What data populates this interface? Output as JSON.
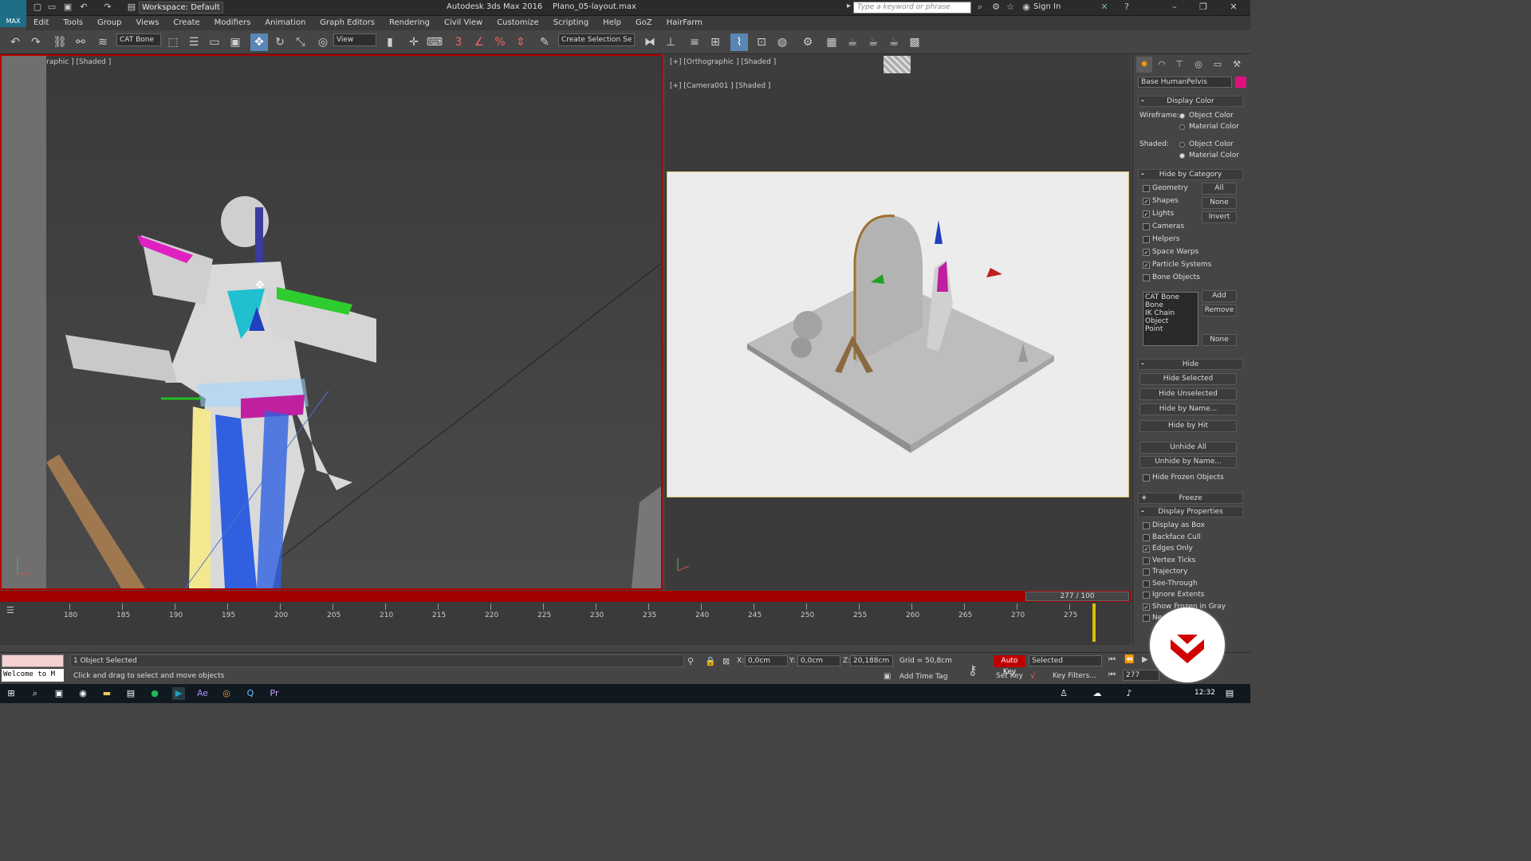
{
  "window": {
    "workspace_label": "Workspace: Default",
    "app_title": "Autodesk 3ds Max 2016",
    "file_name": "Plano_05-layout.max",
    "search_placeholder": "Type a keyword or phrase",
    "sign_in": "Sign In",
    "logo_text": "MAX"
  },
  "menu": [
    "Edit",
    "Tools",
    "Group",
    "Views",
    "Create",
    "Modifiers",
    "Animation",
    "Graph Editors",
    "Rendering",
    "Civil View",
    "Customize",
    "Scripting",
    "Help",
    "GoZ",
    "HairFarm"
  ],
  "toolbar": {
    "selection_filter": "CAT Bone",
    "ref_coord": "View",
    "named_selection": "Create Selection Se"
  },
  "viewports": {
    "left_label": "[+] [Orthographic ] [Shaded ]",
    "right_top_label": "[+] [Orthographic ] [Shaded ]",
    "right_label": "[+] [Camera001 ] [Shaded ]"
  },
  "command_panel": {
    "object_name": "Base HumanPelvis",
    "object_color": "#e0117f",
    "display_color": {
      "title": "Display Color",
      "wireframe_label": "Wireframe:",
      "shaded_label": "Shaded:",
      "object_color": "Object Color",
      "material_color": "Material Color"
    },
    "hide_by_category": {
      "title": "Hide by Category",
      "items": [
        {
          "label": "Geometry",
          "checked": false
        },
        {
          "label": "Shapes",
          "checked": true
        },
        {
          "label": "Lights",
          "checked": true
        },
        {
          "label": "Cameras",
          "checked": false
        },
        {
          "label": "Helpers",
          "checked": false
        },
        {
          "label": "Space Warps",
          "checked": true
        },
        {
          "label": "Particle Systems",
          "checked": true
        },
        {
          "label": "Bone Objects",
          "checked": false
        }
      ],
      "buttons": [
        "All",
        "None",
        "Invert"
      ],
      "list": [
        "CAT Bone",
        "Bone",
        "IK Chain Object",
        "Point"
      ],
      "list_buttons": [
        "Add",
        "Remove",
        "None"
      ]
    },
    "hide": {
      "title": "Hide",
      "buttons": [
        "Hide Selected",
        "Hide Unselected",
        "Hide by Name...",
        "Hide by Hit",
        "Unhide All",
        "Unhide by Name..."
      ],
      "frozen_label": "Hide Frozen Objects"
    },
    "freeze_title": "Freeze",
    "display_properties": {
      "title": "Display Properties",
      "items": [
        {
          "label": "Display as Box",
          "checked": false
        },
        {
          "label": "Backface Cull",
          "checked": false
        },
        {
          "label": "Edges Only",
          "checked": true
        },
        {
          "label": "Vertex Ticks",
          "checked": false
        },
        {
          "label": "Trajectory",
          "checked": false
        },
        {
          "label": "See-Through",
          "checked": false
        },
        {
          "label": "Ignore Extents",
          "checked": false
        },
        {
          "label": "Show Frozen in Gray",
          "checked": true
        },
        {
          "label": "Ne",
          "checked": false
        }
      ]
    }
  },
  "timeline": {
    "slider_text": "277 / 100",
    "ticks": [
      "180",
      "185",
      "190",
      "195",
      "200",
      "205",
      "210",
      "215",
      "220",
      "225",
      "230",
      "235",
      "240",
      "245",
      "250",
      "255",
      "260",
      "265",
      "270",
      "275"
    ]
  },
  "status": {
    "maxscript": "Welcome to M",
    "selected": "1 Object Selected",
    "prompt": "Click and drag to select and move objects",
    "x_label": "X:",
    "x_value": "0,0cm",
    "y_label": "Y:",
    "y_value": "0,0cm",
    "z_label": "Z:",
    "z_value": "20,188cm",
    "grid": "Grid = 50,8cm",
    "add_time_tag": "Add Time Tag",
    "auto_key": "Auto Key",
    "set_key": "Set Key",
    "key_mode": "Selected",
    "key_filters": "Key Filters...",
    "frame": "277"
  },
  "taskbar": {
    "clock": "12:32"
  }
}
